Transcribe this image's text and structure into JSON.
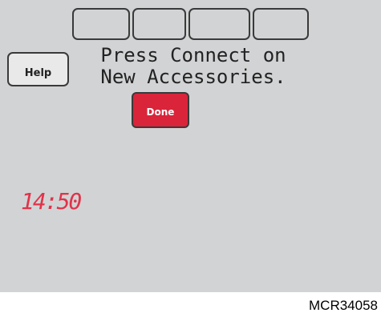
{
  "message": {
    "line1": "Press Connect on",
    "line2": "New Accessories."
  },
  "buttons": {
    "help_label": "Help",
    "done_label": "Done"
  },
  "status": {
    "time": "14:50"
  },
  "figure": {
    "code": "MCR34058"
  },
  "colors": {
    "screen_background": "#d2d3d4",
    "done_button": "#d9243a",
    "time_display": "#e0334a"
  }
}
